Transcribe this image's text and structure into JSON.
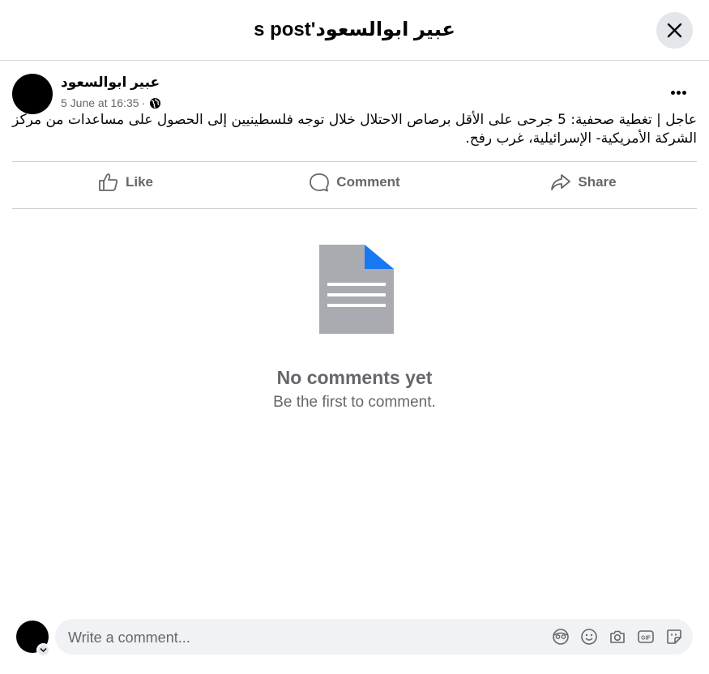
{
  "dialog": {
    "title": "عبير ابوالسعود's post",
    "close_icon": "close-icon"
  },
  "post": {
    "author": "عبير ابوالسعود",
    "date": "5 June at 16:35",
    "separator": "·",
    "privacy_icon": "globe-icon",
    "more_icon": "more-options-icon",
    "text": "عاجل | تغطية صحفية: 5 جرحى على الأقل برصاص الاحتلال خلال توجه فلسطينيين إلى الحصول على مساعدات من مركز الشركة الأمريكية- الإسرائيلية، غرب رفح."
  },
  "actions": [
    {
      "label": "Like",
      "icon": "like-icon"
    },
    {
      "label": "Comment",
      "icon": "comment-icon"
    },
    {
      "label": "Share",
      "icon": "share-icon"
    }
  ],
  "empty_state": {
    "icon": "document-icon",
    "title": "No comments yet",
    "subtitle": "Be the first to comment."
  },
  "composer": {
    "placeholder": "Write a comment...",
    "icons": [
      "avatar-sticker-icon",
      "emoji-icon",
      "camera-icon",
      "gif-icon",
      "sticker-icon"
    ]
  },
  "colors": {
    "secondary_text": "#65676b",
    "button_bg": "#e4e6eb",
    "input_bg": "#f0f2f5",
    "doc_blue": "#1877f2",
    "doc_gray": "#a9abb0"
  }
}
